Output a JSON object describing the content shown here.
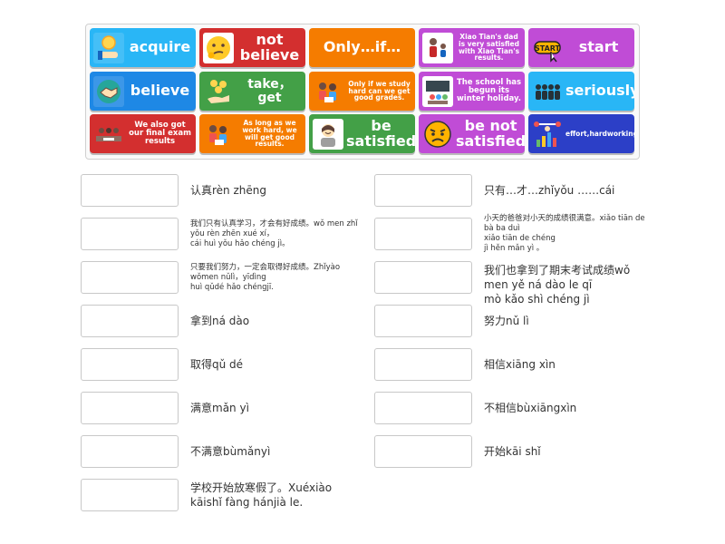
{
  "colors": {
    "blue": "#1e88e5",
    "red": "#d32f2f",
    "orange": "#f57c00",
    "purple": "#c04cd6",
    "sky": "#29b6f6",
    "green": "#43a047",
    "navy": "#2c3fc7"
  },
  "tiles": [
    {
      "text": "acquire",
      "icon": "hand-coin-icon"
    },
    {
      "text": "not believe",
      "icon": "thinking-face-icon"
    },
    {
      "text": "Only…if…",
      "icon": ""
    },
    {
      "text": "Xiao Tian's dad is very satisfied with Xiao Tian's results.",
      "icon": "father-son-icon"
    },
    {
      "text": "start",
      "icon": "start-button-icon"
    },
    {
      "text": "believe",
      "icon": "handshake-icon"
    },
    {
      "text": "take，get",
      "icon": "hand-coins-icon"
    },
    {
      "text": "Only if we study hard can we get good grades.",
      "icon": "students-icon"
    },
    {
      "text": "The school has begun its winter holiday.",
      "icon": "classroom-icon"
    },
    {
      "text": "seriously",
      "icon": "people-group-icon"
    },
    {
      "text": "We also got our final exam results",
      "icon": "exam-icon"
    },
    {
      "text": "As long as we work hard, we will get good results.",
      "icon": "students-icon"
    },
    {
      "text": "be satisfied",
      "icon": "happy-person-icon"
    },
    {
      "text": "be not satisfied",
      "icon": "angry-face-icon"
    },
    {
      "text": "effort,hardworking",
      "icon": "weightlifter-icon"
    }
  ],
  "left_labels": [
    "认真rèn zhēng",
    "我们只有认真学习，才会有好成绩。wǒ men zhǐ yǒu rèn zhēn xué xí，\ncái huì yǒu hǎo chéng jì。",
    "只要我们努力，一定会取得好成绩。Zhǐyào wǒmen nǔlì，yīdìng\nhuì qǔdé hǎo chéngjī.",
    "拿到ná dào",
    "取得qǔ dé",
    "满意mǎn yì",
    "不满意bùmǎnyì",
    "学校开始放寒假了。Xuéxiào kāishǐ fàng hánjià le."
  ],
  "right_labels": [
    "只有…才…zhǐyǒu ……cái",
    "小天的爸爸对小天的成绩很满意。xiǎo tiān de bà ba duì\nxiǎo tiān de chéng\njì hěn mǎn yì 。",
    "我们也拿到了期末考试成绩wǒ men yě ná dào le qī\nmò kǎo shì chéng jì",
    "努力nǔ lì",
    "相信xiāng xìn",
    "不相信bùxiāngxìn",
    "开始kāi shǐ"
  ]
}
